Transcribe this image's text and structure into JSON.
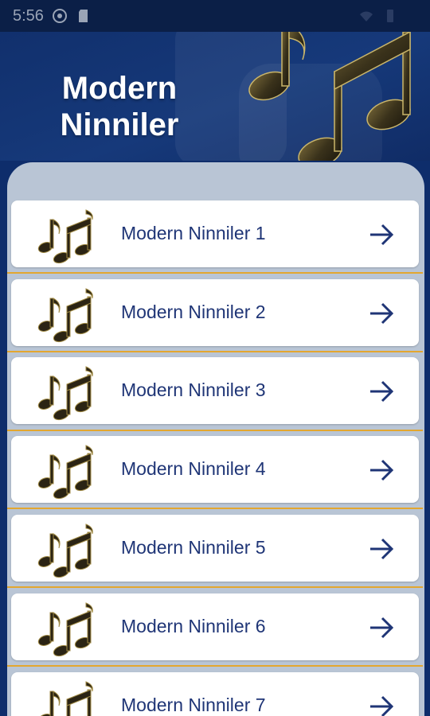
{
  "status_bar": {
    "time": "5:56"
  },
  "header": {
    "title_line1": "Modern",
    "title_line2": "Ninniler"
  },
  "items": [
    {
      "label": "Modern Ninniler 1"
    },
    {
      "label": "Modern Ninniler 2"
    },
    {
      "label": "Modern Ninniler 3"
    },
    {
      "label": "Modern Ninniler 4"
    },
    {
      "label": "Modern Ninniler 5"
    },
    {
      "label": "Modern Ninniler 6"
    },
    {
      "label": "Modern Ninniler 7"
    }
  ],
  "icons": {
    "item": "music-notes-icon",
    "action": "arrow-right-icon"
  },
  "colors": {
    "header_bg": "#11306d",
    "panel_bg": "#b9c5d5",
    "label": "#1f3576",
    "separator": "#e3a72f"
  }
}
